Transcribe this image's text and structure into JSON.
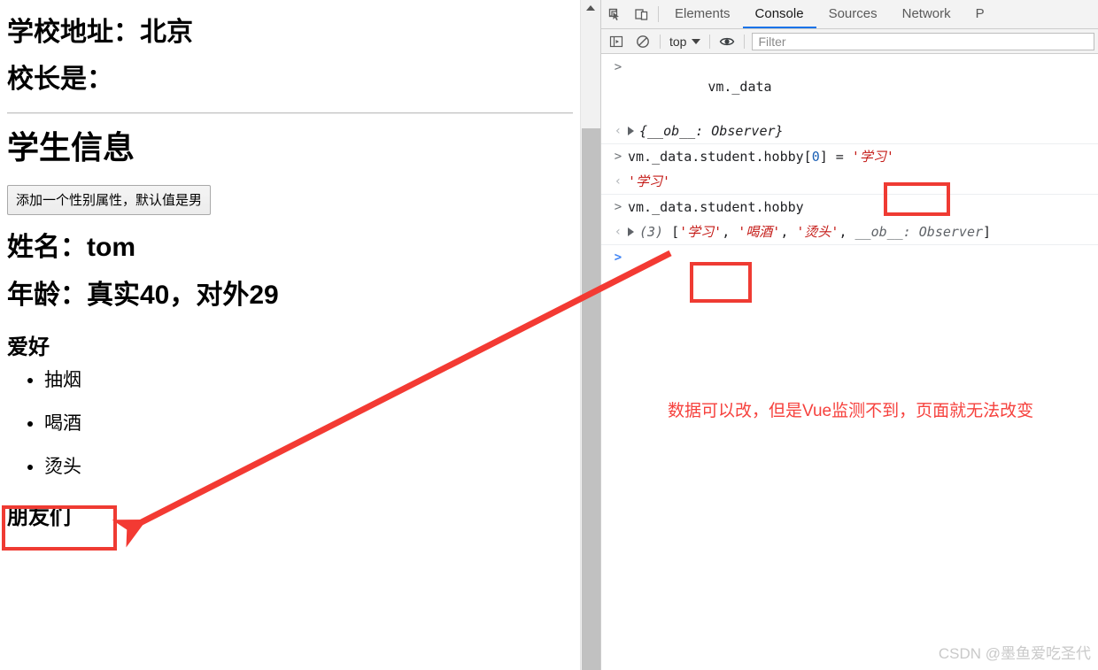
{
  "page": {
    "school_address": "学校地址：北京",
    "principal": "校长是：",
    "section_title": "学生信息",
    "add_gender_button": "添加一个性别属性，默认值是男",
    "name_line": "姓名：tom",
    "age_line": "年龄：真实40，对外29",
    "hobby_heading": "爱好",
    "hobbies": [
      "抽烟",
      "喝酒",
      "烫头"
    ],
    "next_heading_partial": "朋友们"
  },
  "devtools": {
    "tabs": [
      {
        "label": "Elements",
        "active": false
      },
      {
        "label": "Console",
        "active": true
      },
      {
        "label": "Sources",
        "active": false
      },
      {
        "label": "Network",
        "active": false
      },
      {
        "label": "P",
        "active": false
      }
    ],
    "icons": {
      "inspect": "inspect-element-icon",
      "device": "device-toolbar-icon",
      "sidebar": "console-sidebar-icon",
      "clear": "clear-console-icon",
      "eye": "live-expression-icon"
    },
    "filter_bar": {
      "context": "top",
      "filter_placeholder": "Filter",
      "filter_value": ""
    },
    "console_rows": [
      {
        "kind": "input",
        "gutter": ">",
        "parts": [
          {
            "t": "vm._data",
            "c": "plain"
          }
        ]
      },
      {
        "kind": "output",
        "gutter": "<",
        "expandable": true,
        "parts": [
          {
            "t": "{__ob__: Observer}",
            "c": "obj"
          }
        ]
      },
      {
        "kind": "input",
        "gutter": ">",
        "parts": [
          {
            "t": "vm._data.student.hobby[",
            "c": "plain"
          },
          {
            "t": "0",
            "c": "num"
          },
          {
            "t": "] = ",
            "c": "plain"
          },
          {
            "t": "'学习'",
            "c": "str"
          }
        ]
      },
      {
        "kind": "output",
        "gutter": "<",
        "parts": [
          {
            "t": "'学习'",
            "c": "str"
          }
        ]
      },
      {
        "kind": "input",
        "gutter": ">",
        "parts": [
          {
            "t": "vm._data.student.hobby",
            "c": "plain"
          }
        ]
      },
      {
        "kind": "output",
        "gutter": "<",
        "expandable": true,
        "parts": [
          {
            "t": "(3) ",
            "c": "grey"
          },
          {
            "t": "[",
            "c": "plain"
          },
          {
            "t": "'学习'",
            "c": "str"
          },
          {
            "t": ", ",
            "c": "plain"
          },
          {
            "t": "'喝酒'",
            "c": "str"
          },
          {
            "t": ", ",
            "c": "plain"
          },
          {
            "t": "'烫头'",
            "c": "str"
          },
          {
            "t": ", ",
            "c": "plain"
          },
          {
            "t": "__ob__: Observer",
            "c": "grey"
          },
          {
            "t": "]",
            "c": "plain"
          }
        ]
      },
      {
        "kind": "prompt",
        "gutter": ">",
        "parts": []
      }
    ]
  },
  "annotations": {
    "note_text": "数据可以改，但是Vue监测不到，页面就无法改变",
    "note_color": "#f6413d",
    "highlight_color": "#ef3b33",
    "arrow_color": "#f33a33"
  },
  "watermark": "CSDN @墨鱼爱吃圣代"
}
